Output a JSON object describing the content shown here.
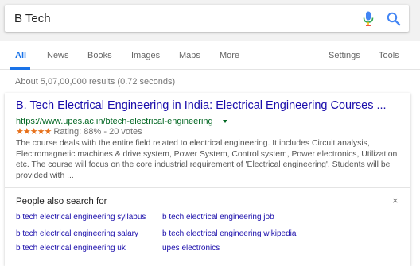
{
  "search": {
    "query": "B Tech"
  },
  "icons": {
    "mic": "microphone-icon",
    "search": "search-icon",
    "close": "close-icon",
    "caret": "caret-down-icon"
  },
  "colors": {
    "accent": "#1a73e8",
    "link": "#1a0dab",
    "url": "#006621",
    "stars": "#e7711b"
  },
  "tabs": [
    {
      "label": "All",
      "active": true
    },
    {
      "label": "News"
    },
    {
      "label": "Books"
    },
    {
      "label": "Images"
    },
    {
      "label": "Maps"
    },
    {
      "label": "More"
    },
    {
      "label": "Settings"
    },
    {
      "label": "Tools"
    }
  ],
  "result_stats": "About 5,07,00,000 results (0.72 seconds)",
  "result": {
    "title": "B. Tech Electrical Engineering in India: Electrical Engineering Courses ...",
    "url": "https://www.upes.ac.in/btech-electrical-engineering",
    "stars": "★★★★★",
    "rating_text": "Rating: 88% - 20 votes",
    "snippet": [
      "The course deals with the entire field related to electrical engineering. It includes Circuit analysis,",
      "Electromagnetic machines & drive system, Power System, Control system, Power electronics, Utilization",
      "etc. The course will focus on the core industrial requirement of 'Electrical engineering'. Students will be",
      "provided with ..."
    ]
  },
  "people_also_search": {
    "title": "People also search for",
    "close": "×",
    "links": [
      "b tech electrical engineering syllabus",
      "b tech electrical engineering job",
      "b tech electrical engineering salary",
      "b tech electrical engineering wikipedia",
      "b tech electrical engineering uk",
      "upes electronics"
    ]
  }
}
